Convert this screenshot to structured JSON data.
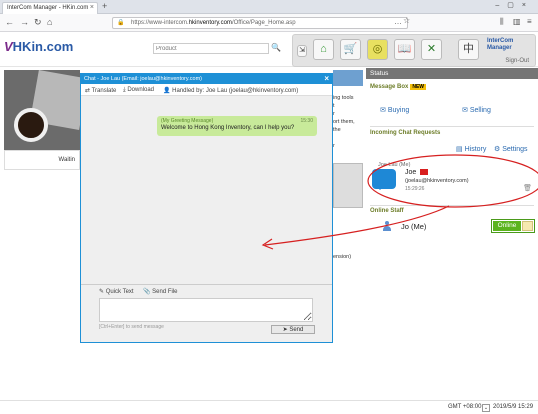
{
  "browser": {
    "tab_title": "InterCom Manager - HKin.com",
    "url_prefix": "https://www-intercom.",
    "url_domain": "hkinventory.com",
    "url_path": "/Office/Page_Home.asp"
  },
  "site": {
    "logo_v": "V",
    "logo_text": "HKin.com",
    "search_placeholder": "Product",
    "intercom_logo_line1": "InterCom",
    "intercom_logo_line2": "Manager",
    "sign_out": "Sign-Out",
    "toolbar_icons": [
      "home-icon",
      "cart-icon",
      "coins-icon",
      "book-icon",
      "tools-icon",
      "chinese-char-icon"
    ],
    "chinese_label": "中",
    "hero_caption": "Waitin",
    "right_fragments": [
      "ing tools",
      "t",
      "r",
      "ort them,",
      "the",
      "r",
      "ension)"
    ]
  },
  "chat": {
    "title": "Chat - Joe Lau (Email: joelau@hkinventory.com)",
    "tools": {
      "translate": "Translate",
      "download": "Download",
      "handled_by": "Handled by: Joe Lau (joelau@hkinventory.com)"
    },
    "messages": [
      {
        "greeting": "(My Greeting Message)",
        "time": "15:30",
        "text": "Welcome to Hong Kong Inventory, can I help you?"
      }
    ],
    "input": {
      "quick_text": "Quick Text",
      "send_file": "Send File",
      "hint": "[Ctrl+Enter] to send message",
      "send_label": "Send"
    }
  },
  "status": {
    "header": "Status",
    "message_box": "Message Box",
    "new_badge": "NEW",
    "buying": "Buying",
    "selling": "Selling",
    "incoming_title": "Incoming Chat Requests",
    "history": "History",
    "settings": "Settings",
    "request": {
      "user": "Joe Lau (Me)",
      "name": "Joe",
      "email": "(joelau@hkinventory.com)",
      "time": "15:29:26"
    },
    "online_staff_title": "Online Staff",
    "staff": {
      "name": "Jo (Me)",
      "status": "Online"
    }
  },
  "taskbar": {
    "timezone": "GMT +08:00",
    "datetime": "2019/5/9 15:29"
  },
  "colors": {
    "chat_blue": "#1e90d6",
    "online_green": "#5bb41e",
    "annotation_red": "#d62020"
  }
}
